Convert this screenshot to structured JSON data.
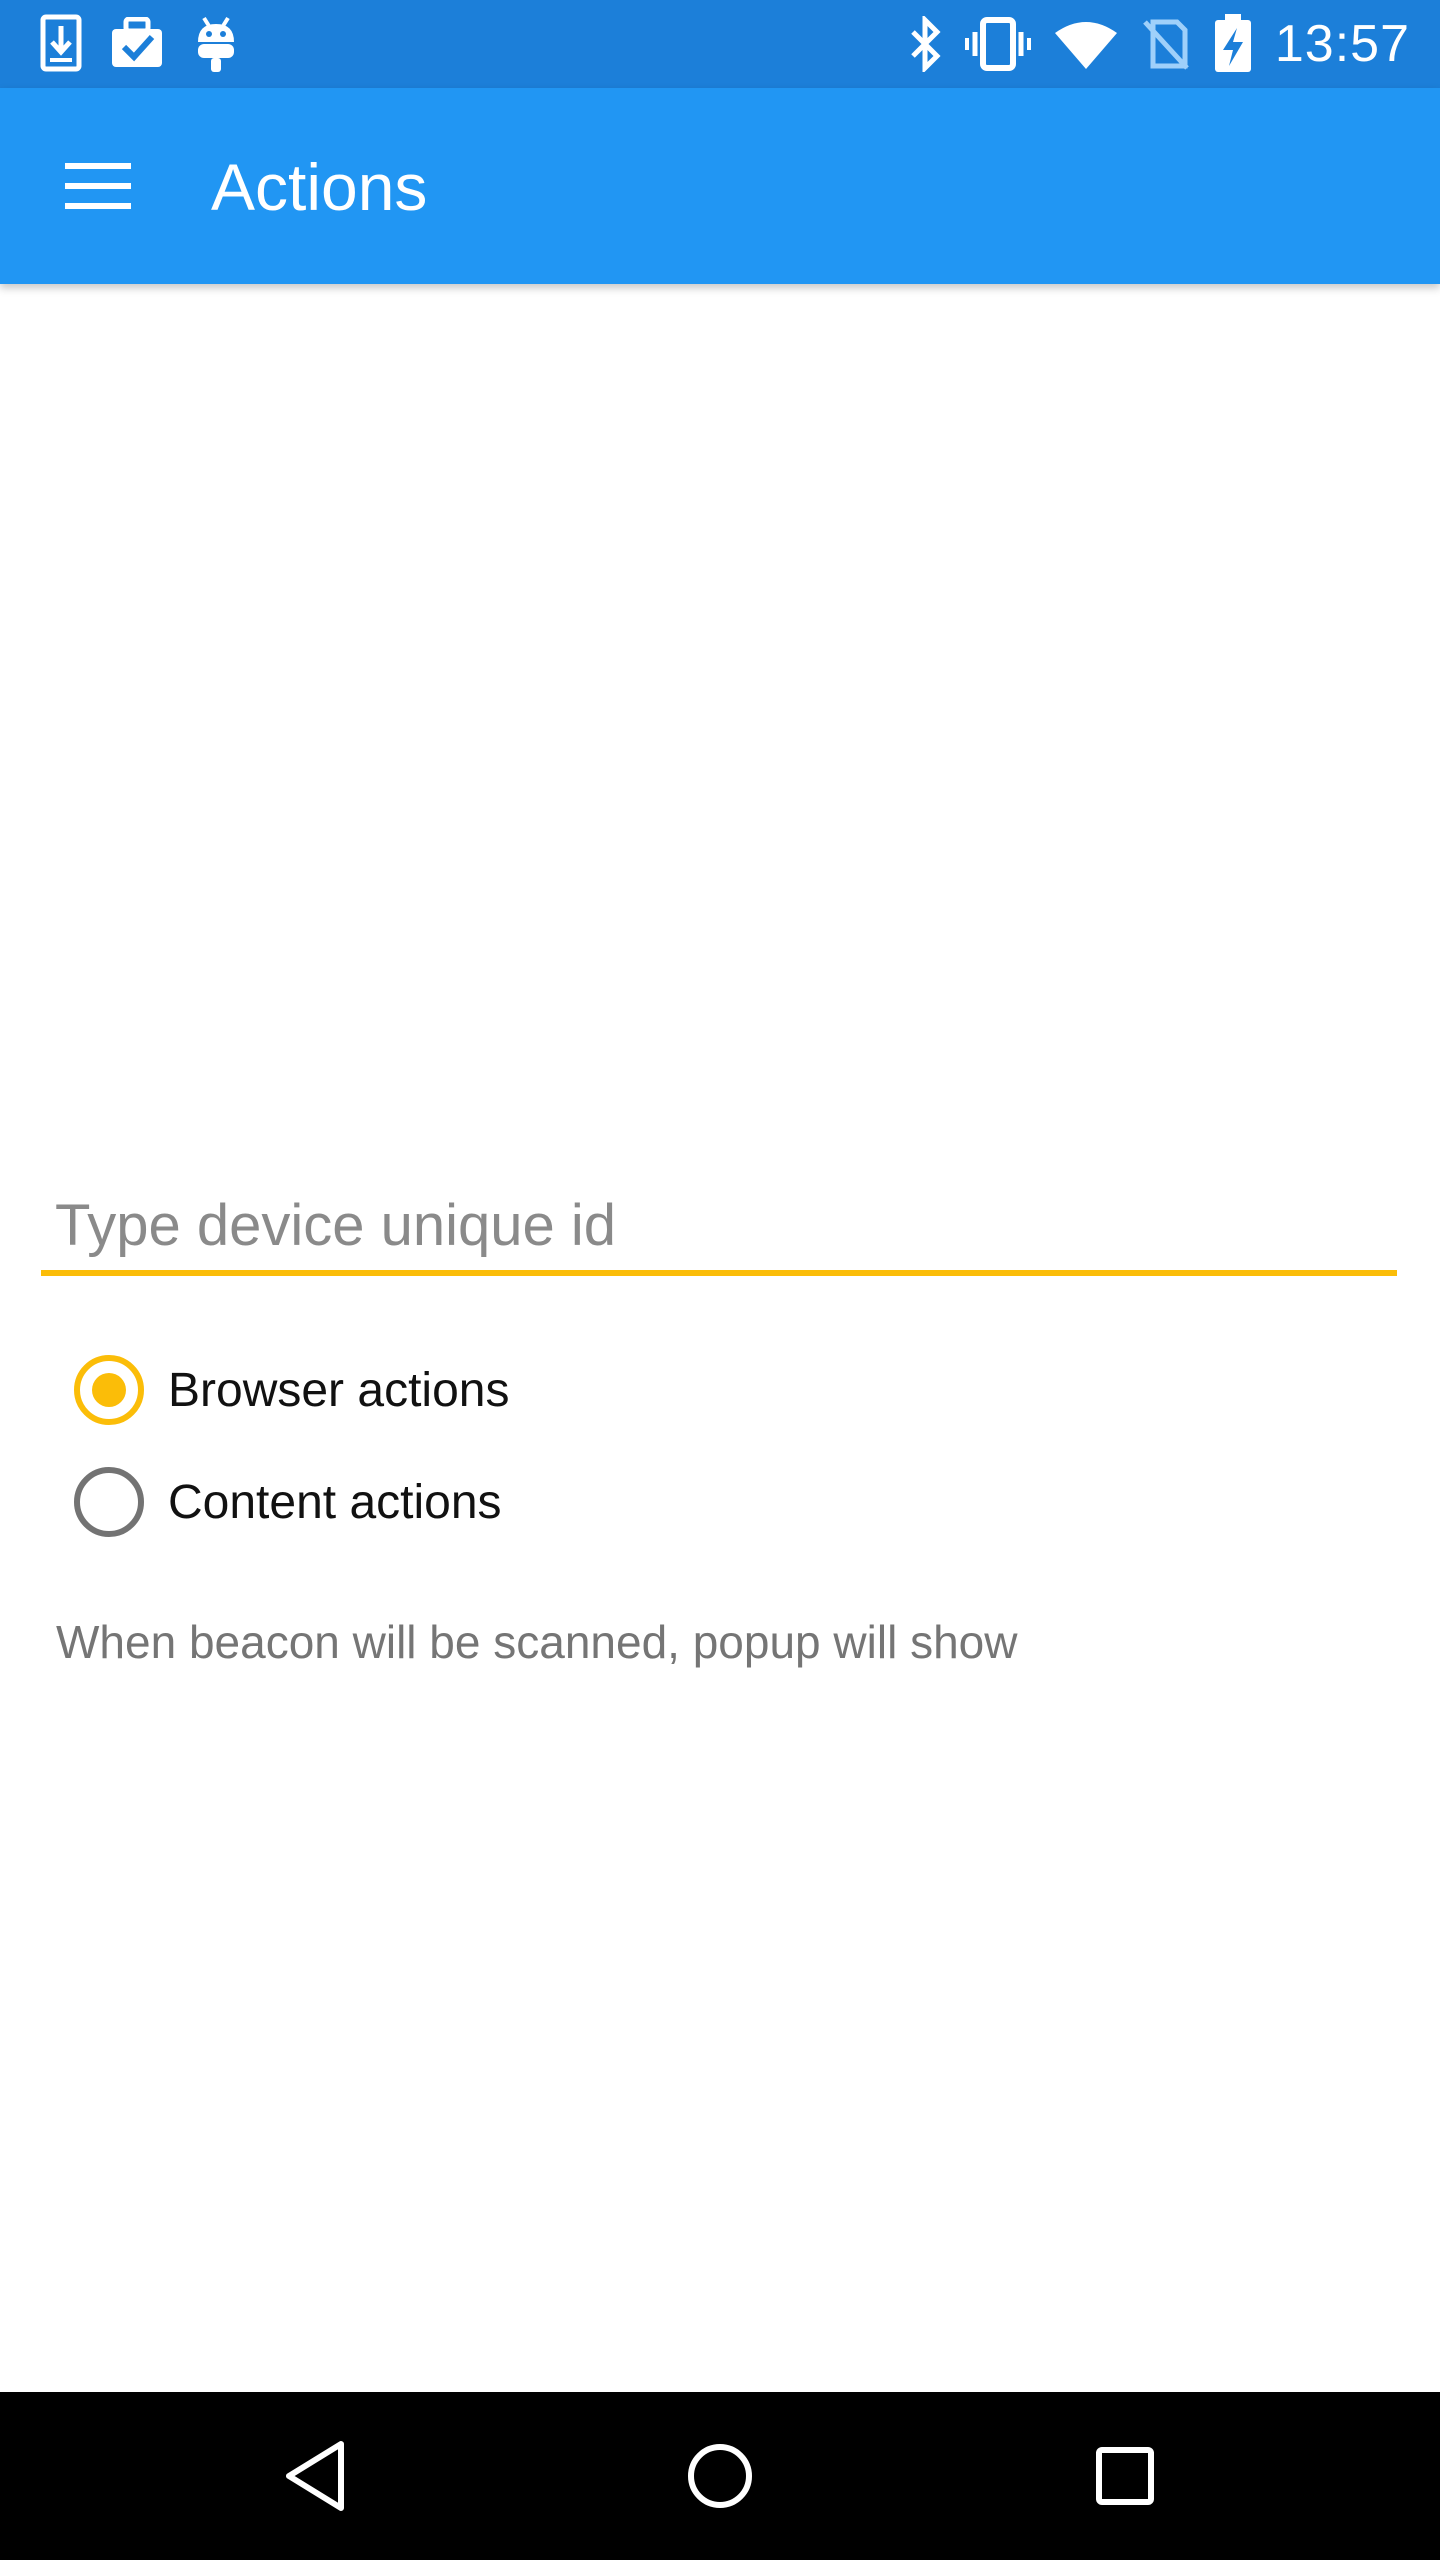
{
  "status_bar": {
    "time": "13:57",
    "left_icons": [
      "download-icon",
      "briefcase-check-icon",
      "android-icon"
    ],
    "right_icons": [
      "bluetooth-icon",
      "vibrate-icon",
      "wifi-icon",
      "no-sim-icon",
      "battery-charging-icon"
    ]
  },
  "app_bar": {
    "title": "Actions",
    "menu_icon": "menu-icon",
    "color": "#2196f3"
  },
  "form": {
    "device_id_placeholder": "Type device unique id",
    "device_id_value": "",
    "options": [
      {
        "label": "Browser actions",
        "selected": true
      },
      {
        "label": "Content actions",
        "selected": false
      }
    ],
    "hint": "When beacon will be scanned, popup will show",
    "accent_color": "#fbbd08"
  },
  "nav_bar": {
    "buttons": [
      "back-icon",
      "home-icon",
      "recents-icon"
    ]
  }
}
